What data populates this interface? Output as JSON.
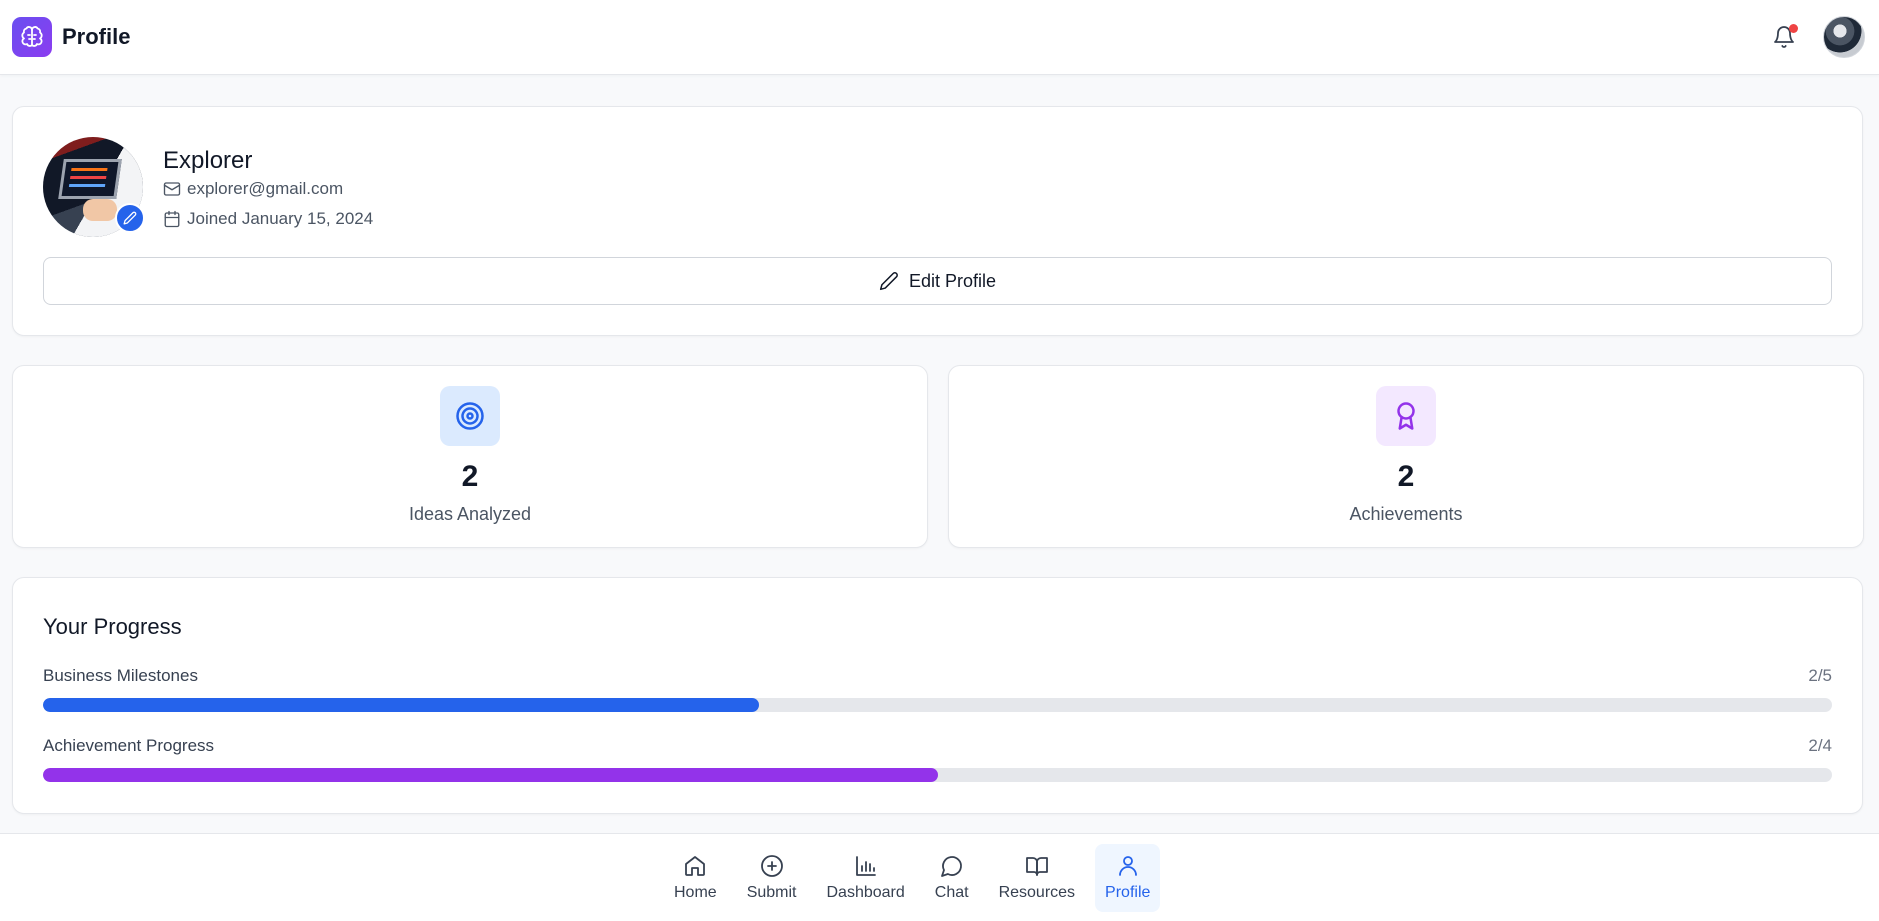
{
  "header": {
    "title": "Profile",
    "notification_dot": true
  },
  "profile": {
    "name": "Explorer",
    "email": "explorer@gmail.com",
    "joined": "Joined January 15, 2024",
    "edit_button_label": "Edit Profile"
  },
  "stats": [
    {
      "value": "2",
      "label": "Ideas Analyzed",
      "icon": "target-icon",
      "color": "#2563eb"
    },
    {
      "value": "2",
      "label": "Achievements",
      "icon": "award-icon",
      "color": "#9333ea"
    }
  ],
  "progress": {
    "title": "Your Progress",
    "items": [
      {
        "label": "Business Milestones",
        "count": "2/5",
        "fraction": 0.4,
        "color": "#2563eb"
      },
      {
        "label": "Achievement Progress",
        "count": "2/4",
        "fraction": 0.5,
        "color": "#9333ea"
      }
    ]
  },
  "nav": {
    "items": [
      {
        "label": "Home",
        "icon": "home-icon"
      },
      {
        "label": "Submit",
        "icon": "plus-circle-icon"
      },
      {
        "label": "Dashboard",
        "icon": "bar-chart-icon"
      },
      {
        "label": "Chat",
        "icon": "chat-bubble-icon"
      },
      {
        "label": "Resources",
        "icon": "book-open-icon"
      },
      {
        "label": "Profile",
        "icon": "user-icon",
        "active": true
      }
    ]
  },
  "colors": {
    "accent": "#2563eb",
    "purple": "#9333ea",
    "notification": "#ef4444"
  }
}
